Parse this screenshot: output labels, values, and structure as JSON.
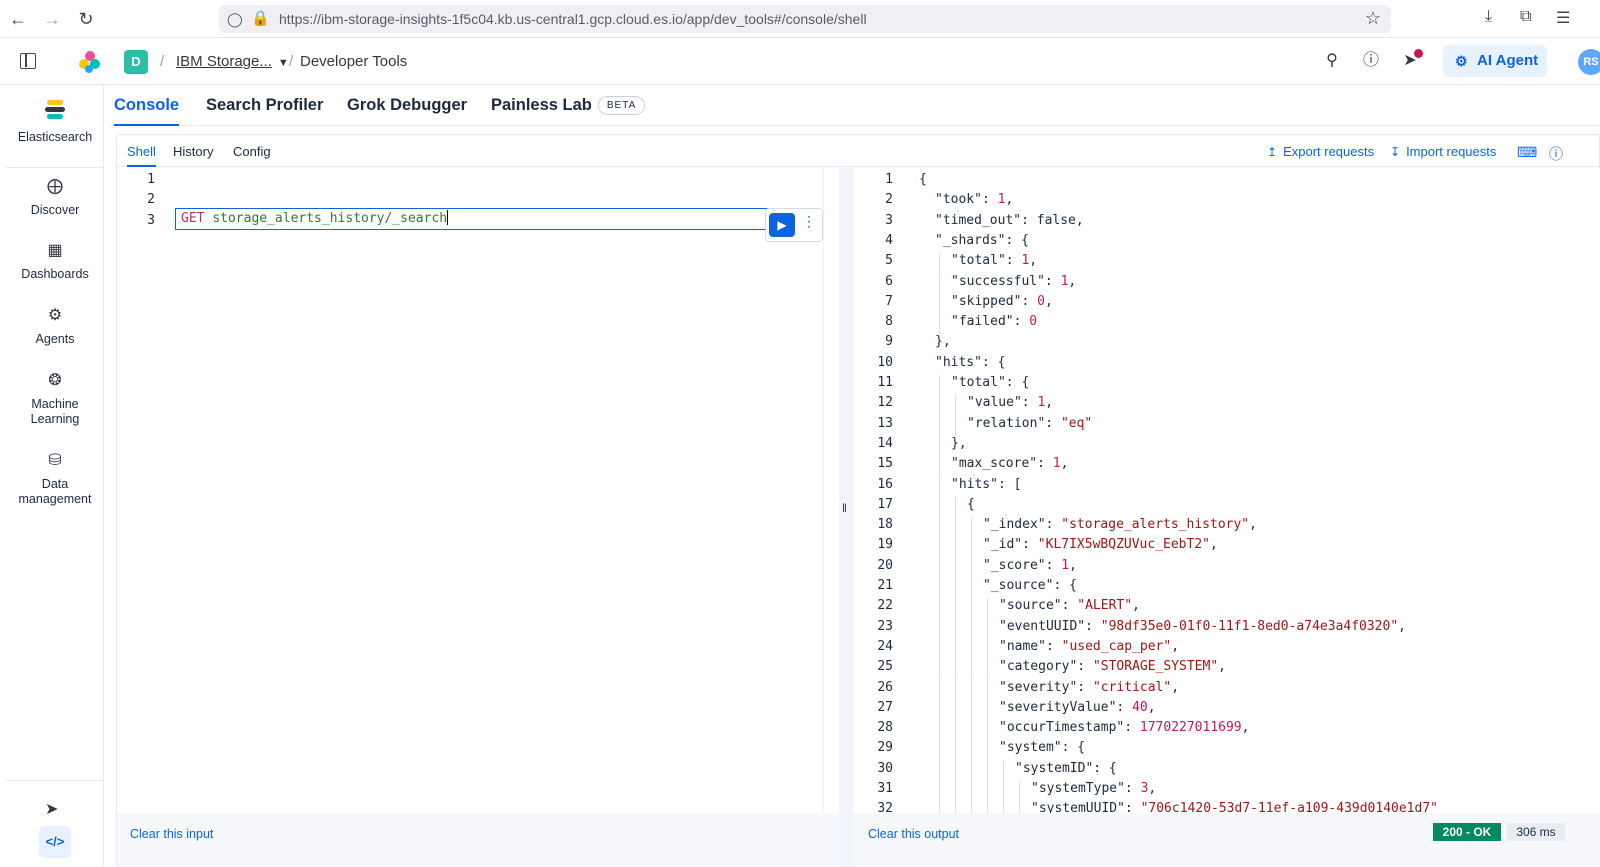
{
  "browser": {
    "url": "https://ibm-storage-insights-1f5c04.kb.us-central1.gcp.cloud.es.io/app/dev_tools#/console/shell"
  },
  "header": {
    "space_letter": "D",
    "breadcrumb_1": "IBM Storage...",
    "breadcrumb_2": "Developer Tools",
    "ai_agent_label": "AI Agent",
    "avatar_initials": "RS"
  },
  "sidenav": {
    "items": [
      {
        "label": "Elasticsearch",
        "icon": "elasticsearch-logo"
      },
      {
        "label": "Discover",
        "icon": "compass-icon"
      },
      {
        "label": "Dashboards",
        "icon": "dashboard-icon"
      },
      {
        "label": "Agents",
        "icon": "robot-icon"
      },
      {
        "label": "Machine Learning",
        "icon": "brain-icon"
      },
      {
        "label": "Data management",
        "icon": "database-icon"
      }
    ]
  },
  "tabs": {
    "console": "Console",
    "search_profiler": "Search Profiler",
    "grok_debugger": "Grok Debugger",
    "painless_lab": "Painless Lab",
    "beta": "BETA"
  },
  "subtabs": {
    "shell": "Shell",
    "history": "History",
    "config": "Config",
    "export": "Export requests",
    "import": "Import requests"
  },
  "editor": {
    "line_numbers": [
      "1",
      "2",
      "3"
    ],
    "method": "GET",
    "path": "storage_alerts_history/_search",
    "clear_label": "Clear this input"
  },
  "output": {
    "clear_label": "Clear this output",
    "status": "200 - OK",
    "time": "306 ms",
    "lines": [
      {
        "n": "1",
        "indent": 0,
        "tokens": [
          [
            "p",
            "{"
          ]
        ]
      },
      {
        "n": "2",
        "indent": 1,
        "tokens": [
          [
            "k",
            "\"took\""
          ],
          [
            "p",
            ": "
          ],
          [
            "n",
            "1"
          ],
          [
            "p",
            ","
          ]
        ]
      },
      {
        "n": "3",
        "indent": 1,
        "tokens": [
          [
            "k",
            "\"timed_out\""
          ],
          [
            "p",
            ": false,"
          ]
        ]
      },
      {
        "n": "4",
        "indent": 1,
        "tokens": [
          [
            "k",
            "\"_shards\""
          ],
          [
            "p",
            ": {"
          ]
        ]
      },
      {
        "n": "5",
        "indent": 2,
        "tokens": [
          [
            "k",
            "\"total\""
          ],
          [
            "p",
            ": "
          ],
          [
            "n",
            "1"
          ],
          [
            "p",
            ","
          ]
        ]
      },
      {
        "n": "6",
        "indent": 2,
        "tokens": [
          [
            "k",
            "\"successful\""
          ],
          [
            "p",
            ": "
          ],
          [
            "n",
            "1"
          ],
          [
            "p",
            ","
          ]
        ]
      },
      {
        "n": "7",
        "indent": 2,
        "tokens": [
          [
            "k",
            "\"skipped\""
          ],
          [
            "p",
            ": "
          ],
          [
            "n",
            "0"
          ],
          [
            "p",
            ","
          ]
        ]
      },
      {
        "n": "8",
        "indent": 2,
        "tokens": [
          [
            "k",
            "\"failed\""
          ],
          [
            "p",
            ": "
          ],
          [
            "n",
            "0"
          ]
        ]
      },
      {
        "n": "9",
        "indent": 1,
        "tokens": [
          [
            "p",
            "},"
          ]
        ]
      },
      {
        "n": "10",
        "indent": 1,
        "tokens": [
          [
            "k",
            "\"hits\""
          ],
          [
            "p",
            ": {"
          ]
        ]
      },
      {
        "n": "11",
        "indent": 2,
        "tokens": [
          [
            "k",
            "\"total\""
          ],
          [
            "p",
            ": {"
          ]
        ]
      },
      {
        "n": "12",
        "indent": 3,
        "tokens": [
          [
            "k",
            "\"value\""
          ],
          [
            "p",
            ": "
          ],
          [
            "n",
            "1"
          ],
          [
            "p",
            ","
          ]
        ]
      },
      {
        "n": "13",
        "indent": 3,
        "tokens": [
          [
            "k",
            "\"relation\""
          ],
          [
            "p",
            ": "
          ],
          [
            "s",
            "\"eq\""
          ]
        ]
      },
      {
        "n": "14",
        "indent": 2,
        "tokens": [
          [
            "p",
            "},"
          ]
        ]
      },
      {
        "n": "15",
        "indent": 2,
        "tokens": [
          [
            "k",
            "\"max_score\""
          ],
          [
            "p",
            ": "
          ],
          [
            "n",
            "1"
          ],
          [
            "p",
            ","
          ]
        ]
      },
      {
        "n": "16",
        "indent": 2,
        "tokens": [
          [
            "k",
            "\"hits\""
          ],
          [
            "p",
            ": ["
          ]
        ]
      },
      {
        "n": "17",
        "indent": 3,
        "tokens": [
          [
            "p",
            "{"
          ]
        ]
      },
      {
        "n": "18",
        "indent": 4,
        "tokens": [
          [
            "k",
            "\"_index\""
          ],
          [
            "p",
            ": "
          ],
          [
            "s",
            "\"storage_alerts_history\""
          ],
          [
            "p",
            ","
          ]
        ]
      },
      {
        "n": "19",
        "indent": 4,
        "tokens": [
          [
            "k",
            "\"_id\""
          ],
          [
            "p",
            ": "
          ],
          [
            "s",
            "\"KL7IX5wBQZUVuc_EebT2\""
          ],
          [
            "p",
            ","
          ]
        ]
      },
      {
        "n": "20",
        "indent": 4,
        "tokens": [
          [
            "k",
            "\"_score\""
          ],
          [
            "p",
            ": "
          ],
          [
            "n",
            "1"
          ],
          [
            "p",
            ","
          ]
        ]
      },
      {
        "n": "21",
        "indent": 4,
        "tokens": [
          [
            "k",
            "\"_source\""
          ],
          [
            "p",
            ": {"
          ]
        ]
      },
      {
        "n": "22",
        "indent": 5,
        "tokens": [
          [
            "k",
            "\"source\""
          ],
          [
            "p",
            ": "
          ],
          [
            "s",
            "\"ALERT\""
          ],
          [
            "p",
            ","
          ]
        ]
      },
      {
        "n": "23",
        "indent": 5,
        "tokens": [
          [
            "k",
            "\"eventUUID\""
          ],
          [
            "p",
            ": "
          ],
          [
            "s",
            "\"98df35e0-01f0-11f1-8ed0-a74e3a4f0320\""
          ],
          [
            "p",
            ","
          ]
        ]
      },
      {
        "n": "24",
        "indent": 5,
        "tokens": [
          [
            "k",
            "\"name\""
          ],
          [
            "p",
            ": "
          ],
          [
            "s",
            "\"used_cap_per\""
          ],
          [
            "p",
            ","
          ]
        ]
      },
      {
        "n": "25",
        "indent": 5,
        "tokens": [
          [
            "k",
            "\"category\""
          ],
          [
            "p",
            ": "
          ],
          [
            "s",
            "\"STORAGE_SYSTEM\""
          ],
          [
            "p",
            ","
          ]
        ]
      },
      {
        "n": "26",
        "indent": 5,
        "tokens": [
          [
            "k",
            "\"severity\""
          ],
          [
            "p",
            ": "
          ],
          [
            "s",
            "\"critical\""
          ],
          [
            "p",
            ","
          ]
        ]
      },
      {
        "n": "27",
        "indent": 5,
        "tokens": [
          [
            "k",
            "\"severityValue\""
          ],
          [
            "p",
            ": "
          ],
          [
            "n",
            "40"
          ],
          [
            "p",
            ","
          ]
        ]
      },
      {
        "n": "28",
        "indent": 5,
        "tokens": [
          [
            "k",
            "\"occurTimestamp\""
          ],
          [
            "p",
            ": "
          ],
          [
            "n",
            "1770227011699"
          ],
          [
            "p",
            ","
          ]
        ]
      },
      {
        "n": "29",
        "indent": 5,
        "tokens": [
          [
            "k",
            "\"system\""
          ],
          [
            "p",
            ": {"
          ]
        ]
      },
      {
        "n": "30",
        "indent": 6,
        "tokens": [
          [
            "k",
            "\"systemID\""
          ],
          [
            "p",
            ": {"
          ]
        ]
      },
      {
        "n": "31",
        "indent": 7,
        "tokens": [
          [
            "k",
            "\"systemType\""
          ],
          [
            "p",
            ": "
          ],
          [
            "n",
            "3"
          ],
          [
            "p",
            ","
          ]
        ]
      },
      {
        "n": "32",
        "indent": 7,
        "tokens": [
          [
            "k",
            "\"systemUUID\""
          ],
          [
            "p",
            ": "
          ],
          [
            "s",
            "\"706c1420-53d7-11ef-a109-439d0140e1d7\""
          ]
        ]
      }
    ]
  },
  "colors": {
    "accent": "#0b64dd",
    "status_ok": "#008a5e"
  }
}
